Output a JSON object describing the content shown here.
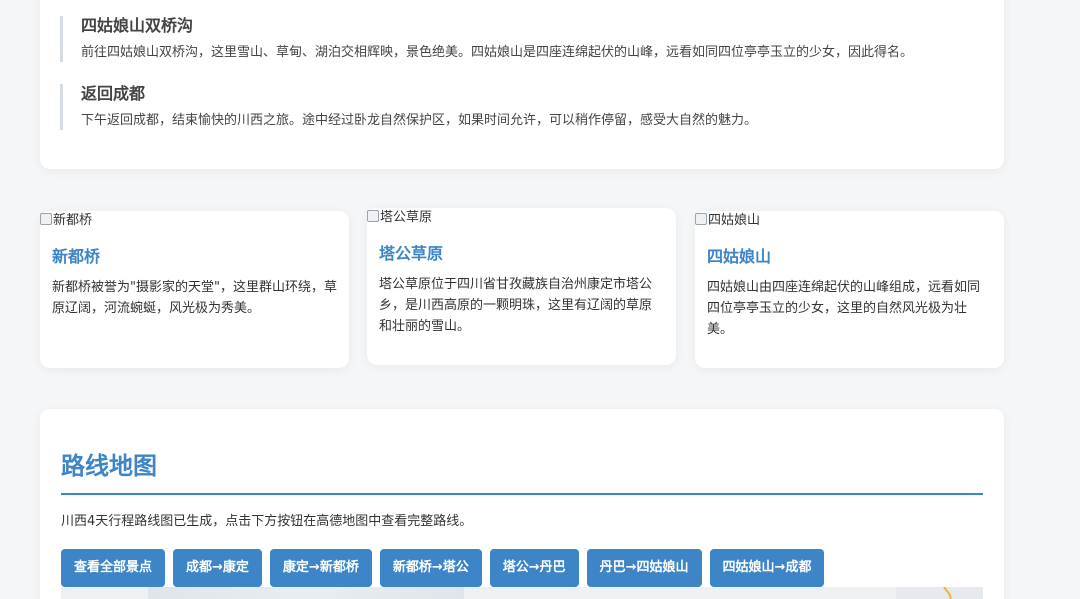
{
  "itinerary": {
    "stops": [
      {
        "title": "四姑娘山双桥沟",
        "desc": "前往四姑娘山双桥沟，这里雪山、草甸、湖泊交相辉映，景色绝美。四姑娘山是四座连绵起伏的山峰，远看如同四位亭亭玉立的少女，因此得名。"
      },
      {
        "title": "返回成都",
        "desc": "下午返回成都，结束愉快的川西之旅。途中经过卧龙自然保护区，如果时间允许，可以稍作停留，感受大自然的魅力。"
      }
    ]
  },
  "spots": [
    {
      "img_alt": "新都桥",
      "title": "新都桥",
      "desc": "新都桥被誉为\"摄影家的天堂\"，这里群山环绕，草原辽阔，河流蜿蜒，风光极为秀美。"
    },
    {
      "img_alt": "塔公草原",
      "title": "塔公草原",
      "desc": "塔公草原位于四川省甘孜藏族自治州康定市塔公乡，是川西高原的一颗明珠，这里有辽阔的草原和壮丽的雪山。"
    },
    {
      "img_alt": "四姑娘山",
      "title": "四姑娘山",
      "desc": "四姑娘山由四座连绵起伏的山峰组成，远看如同四位亭亭玉立的少女，这里的自然风光极为壮美。"
    }
  ],
  "route_map": {
    "title": "路线地图",
    "desc": "川西4天行程路线图已生成，点击下方按钮在高德地图中查看完整路线。",
    "buttons": [
      "查看全部景点",
      "成都→康定",
      "康定→新都桥",
      "新都桥→塔公",
      "塔公→丹巴",
      "丹巴→四姑娘山",
      "四姑娘山→成都"
    ]
  },
  "colors": {
    "accent": "#3d85c6",
    "background": "#f5f6f8",
    "card": "#ffffff"
  }
}
